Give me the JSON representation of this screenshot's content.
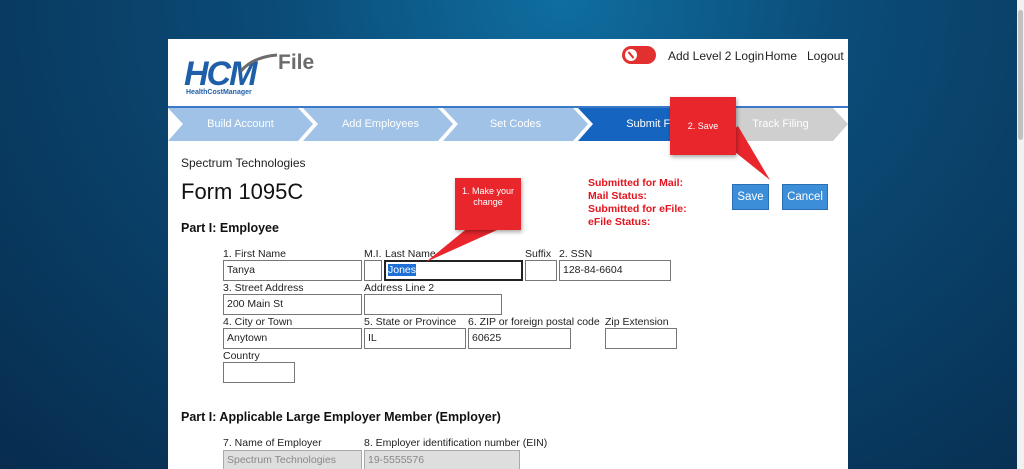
{
  "header": {
    "brand_main": "HCM",
    "brand_file": "File",
    "brand_sub": "HealthCostManager",
    "links": [
      "Add Level 2 Login",
      "Home",
      "Logout"
    ]
  },
  "steps": [
    "Build Account",
    "Add Employees",
    "Set Codes",
    "Submit Filing",
    "Track Filing"
  ],
  "active_step": "Submit Filing",
  "company": "Spectrum Technologies",
  "form_title": "Form 1095C",
  "status_lines": [
    "Submitted for Mail:",
    "Mail Status:",
    "Submitted for eFile:",
    "eFile Status:"
  ],
  "buttons": {
    "save": "Save",
    "cancel": "Cancel"
  },
  "section1": {
    "title": "Part I: Employee",
    "first_name_label": "1. First Name",
    "first_name": "Tanya",
    "mi_label": "M.I.",
    "mi": "",
    "last_name_label": "Last Name",
    "last_name": "Jones",
    "suffix_label": "Suffix",
    "suffix": "",
    "ssn_label": "2. SSN",
    "ssn": "128-84-6604",
    "street_label": "3. Street Address",
    "street": "200 Main St",
    "addr2_label": "Address Line 2",
    "addr2": "",
    "city_label": "4. City or Town",
    "city": "Anytown",
    "state_label": "5. State or Province",
    "state": "IL",
    "zip_label": "6. ZIP or foreign postal code",
    "zip": "60625",
    "zipext_label": "Zip Extension",
    "zipext": "",
    "country_label": "Country",
    "country": ""
  },
  "section2": {
    "title": "Part I: Applicable Large Employer Member (Employer)",
    "employer_label": "7. Name of Employer",
    "employer": "Spectrum Technologies",
    "ein_label": "8. Employer identification number (EIN)",
    "ein": "19-5555576"
  },
  "callouts": {
    "make_change": "1. Make your change",
    "save": "2. Save"
  },
  "colors": {
    "accent": "#3d8ed8",
    "step_inactive": "#9fc2e6",
    "step_active": "#1565c0",
    "step_future": "#cfcfcf",
    "alert": "#e8262c"
  }
}
